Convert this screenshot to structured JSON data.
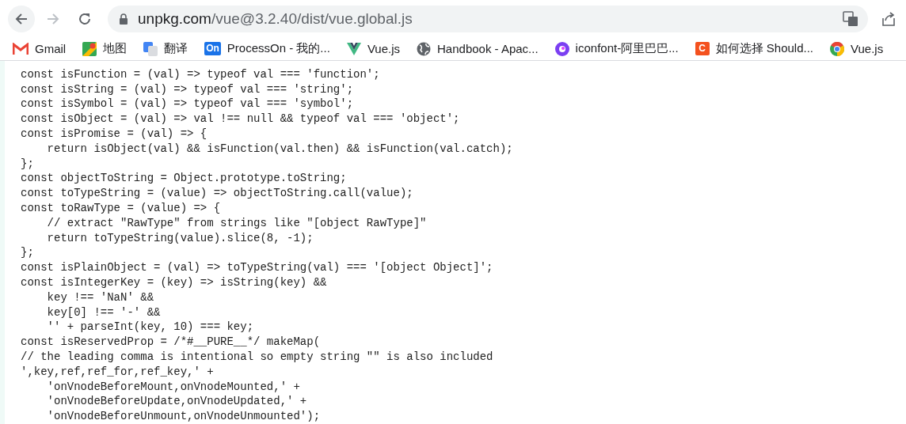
{
  "toolbar": {
    "url_host": "unpkg.com",
    "url_path": "/vue@3.2.40/dist/vue.global.js",
    "forward_disabled": true
  },
  "bookmarks": [
    {
      "kind": "gmail",
      "label": "Gmail"
    },
    {
      "kind": "map",
      "label": "地图"
    },
    {
      "kind": "translate",
      "label": "翻译"
    },
    {
      "kind": "badge",
      "icon_text": "On",
      "color": "#1a73e8",
      "label": "ProcessOn - 我的..."
    },
    {
      "kind": "vue",
      "label": "Vue.js"
    },
    {
      "kind": "globe",
      "label": "Handbook - Apac..."
    },
    {
      "kind": "ring",
      "label": "iconfont-阿里巴巴..."
    },
    {
      "kind": "badge",
      "icon_text": "C",
      "color": "#f4511e",
      "label": "如何选择 Should..."
    },
    {
      "kind": "chrome",
      "label": "Vue.js"
    }
  ],
  "code_lines": [
    "const isFunction = (val) => typeof val === 'function';",
    "const isString = (val) => typeof val === 'string';",
    "const isSymbol = (val) => typeof val === 'symbol';",
    "const isObject = (val) => val !== null && typeof val === 'object';",
    "const isPromise = (val) => {",
    "    return isObject(val) && isFunction(val.then) && isFunction(val.catch);",
    "};",
    "const objectToString = Object.prototype.toString;",
    "const toTypeString = (value) => objectToString.call(value);",
    "const toRawType = (value) => {",
    "    // extract \"RawType\" from strings like \"[object RawType]\"",
    "    return toTypeString(value).slice(8, -1);",
    "};",
    "const isPlainObject = (val) => toTypeString(val) === '[object Object]';",
    "const isIntegerKey = (key) => isString(key) &&",
    "    key !== 'NaN' &&",
    "    key[0] !== '-' &&",
    "    '' + parseInt(key, 10) === key;",
    "const isReservedProp = /*#__PURE__*/ makeMap(",
    "// the leading comma is intentional so empty string \"\" is also included",
    "',key,ref,ref_for,ref_key,' +",
    "    'onVnodeBeforeMount,onVnodeMounted,' +",
    "    'onVnodeBeforeUpdate,onVnodeUpdated,' +",
    "    'onVnodeBeforeUnmount,onVnodeUnmounted');"
  ]
}
